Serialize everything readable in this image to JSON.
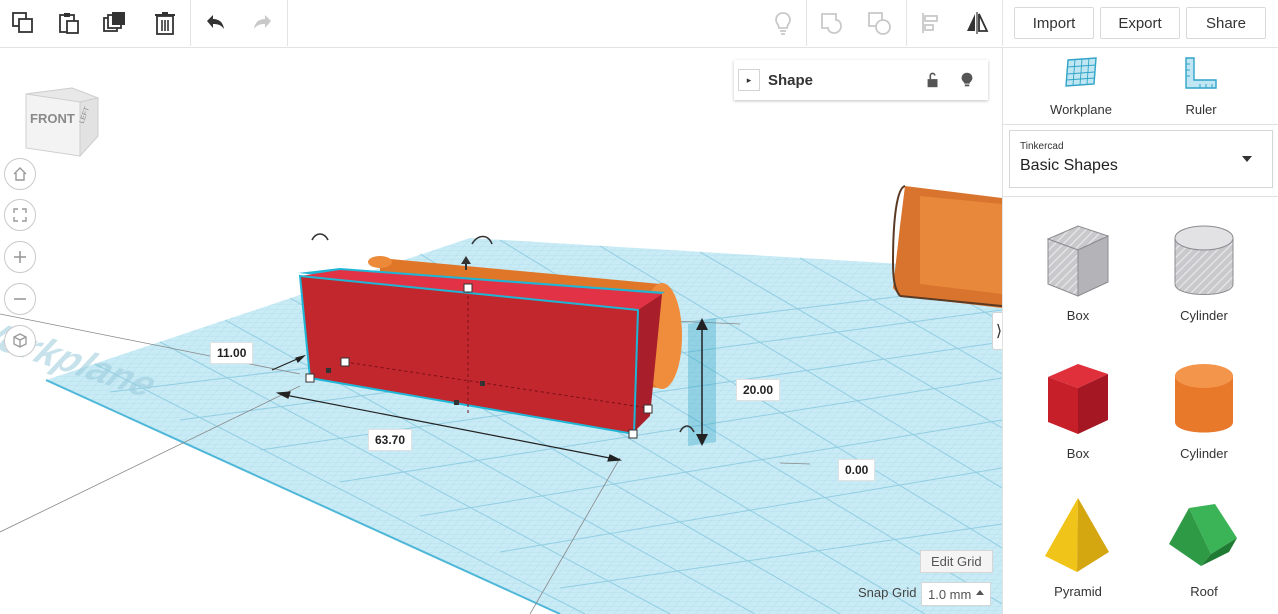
{
  "toolbar": {
    "left_icons": [
      "copy-icon",
      "paste-icon",
      "duplicate-icon",
      "delete-icon",
      "undo-icon",
      "redo-icon"
    ],
    "right_icons": [
      "lightbulb-icon",
      "group-icon",
      "ungroup-icon",
      "align-icon",
      "mirror-icon"
    ],
    "import_label": "Import",
    "export_label": "Export",
    "share_label": "Share"
  },
  "viewcube": {
    "front_label": "FRONT",
    "side_label": "LEFT"
  },
  "nav": [
    "home-icon",
    "fit-icon",
    "zoom-in-icon",
    "zoom-out-icon",
    "perspective-icon"
  ],
  "shape_panel": {
    "title": "Shape",
    "icons": [
      "lock-icon",
      "lightbulb-icon"
    ]
  },
  "workplane": {
    "watermark": "Workplane"
  },
  "dimensions": {
    "width": "63.70",
    "depth": "11.00",
    "height": "20.00",
    "elevation": "0.00"
  },
  "grid": {
    "edit_label": "Edit Grid",
    "snap_label": "Snap Grid",
    "snap_value": "1.0 mm"
  },
  "sidebar": {
    "tools": [
      {
        "label": "Workplane"
      },
      {
        "label": "Ruler"
      }
    ],
    "library": {
      "provider": "Tinkercad",
      "name": "Basic Shapes"
    },
    "shapes": [
      {
        "label": "Box",
        "style": "hole"
      },
      {
        "label": "Cylinder",
        "style": "hole"
      },
      {
        "label": "Box",
        "style": "solid"
      },
      {
        "label": "Cylinder",
        "style": "solid"
      },
      {
        "label": "Pyramid",
        "style": "solid"
      },
      {
        "label": "Roof",
        "style": "solid"
      }
    ]
  },
  "colors": {
    "box_red": "#c1272d",
    "cylinder_orange": "#e8782a",
    "grid_blue": "#bfe6f2",
    "selection_cyan": "#1fb6d6",
    "pyramid_yellow": "#f0c419",
    "roof_green": "#2e9a45"
  }
}
